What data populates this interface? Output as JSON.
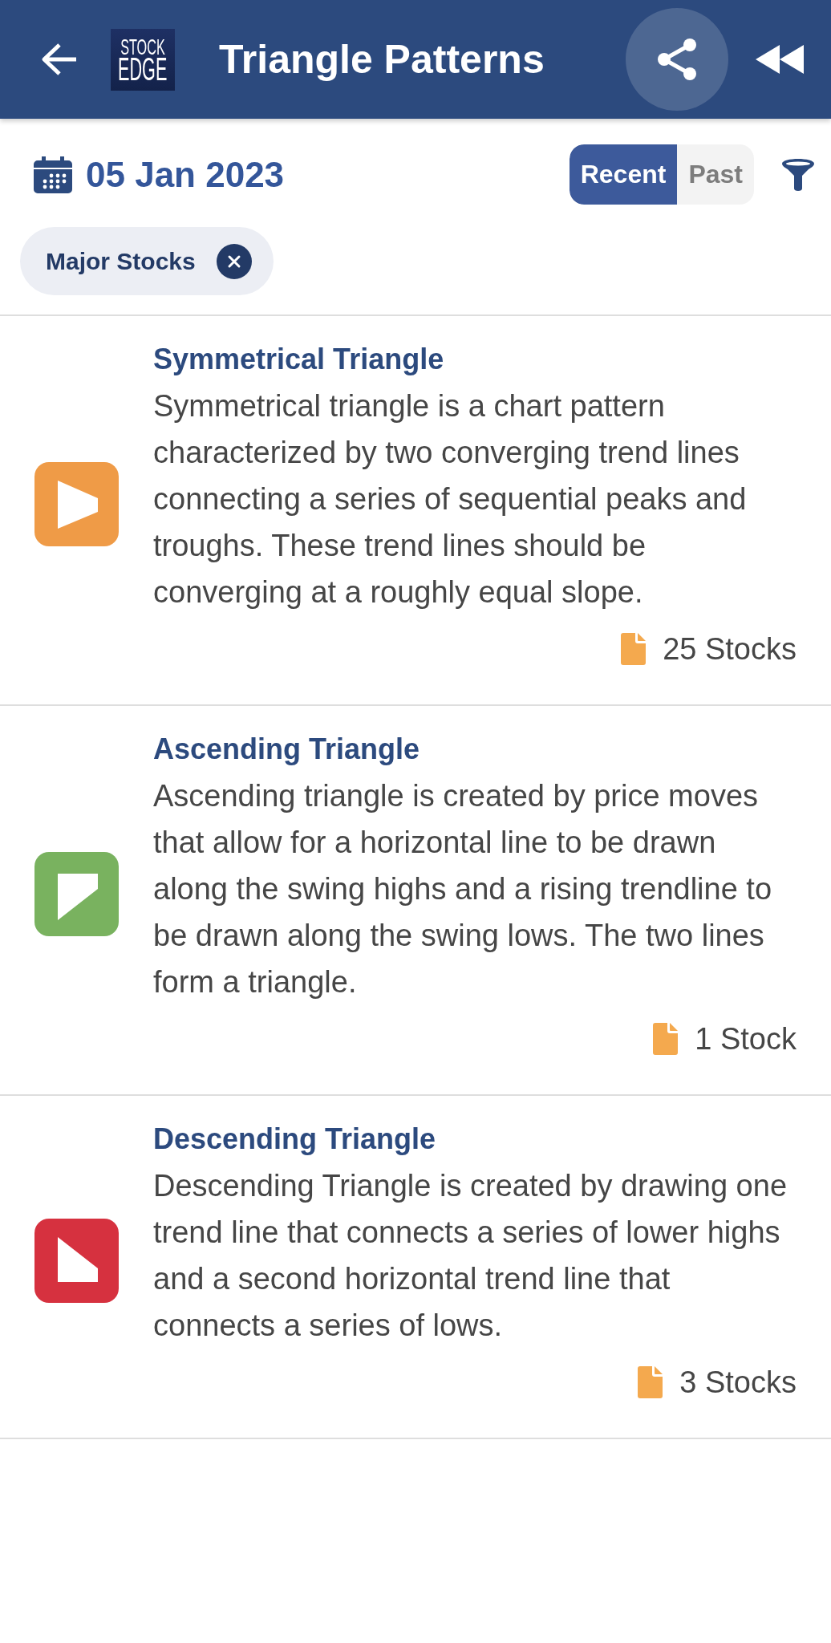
{
  "header": {
    "logo": {
      "line_1": "STOCK",
      "line_2": "EDGE"
    },
    "title": "Triangle Patterns"
  },
  "date": "05 Jan 2023",
  "tabs": [
    {
      "label": "Recent",
      "selected": true
    },
    {
      "label": "Past",
      "selected": false
    }
  ],
  "filter_chips": [
    {
      "label": "Major Stocks"
    }
  ],
  "patterns": [
    {
      "kind": "symmetrical",
      "color": "#ef9b47",
      "title": "Symmetrical Triangle",
      "description": "Symmetrical triangle is a chart pattern characterized by two converging trend lines connecting a series of sequential peaks and troughs. These trend lines should be converging at a roughly equal slope.",
      "count": "25 Stocks"
    },
    {
      "kind": "ascending",
      "color": "#79b25f",
      "title": "Ascending Triangle",
      "description": "Ascending triangle is created by price moves that allow for a horizontal line to be drawn along the swing highs and a rising trendline to be drawn along the swing lows. The two lines form a triangle.",
      "count": "1 Stock"
    },
    {
      "kind": "descending",
      "color": "#d6313f",
      "title": "Descending Triangle",
      "description": "Descending Triangle is created by drawing one trend line that connects a series of lower highs and a second horizontal trend line that connects a series of lows.",
      "count": "3 Stocks"
    }
  ]
}
